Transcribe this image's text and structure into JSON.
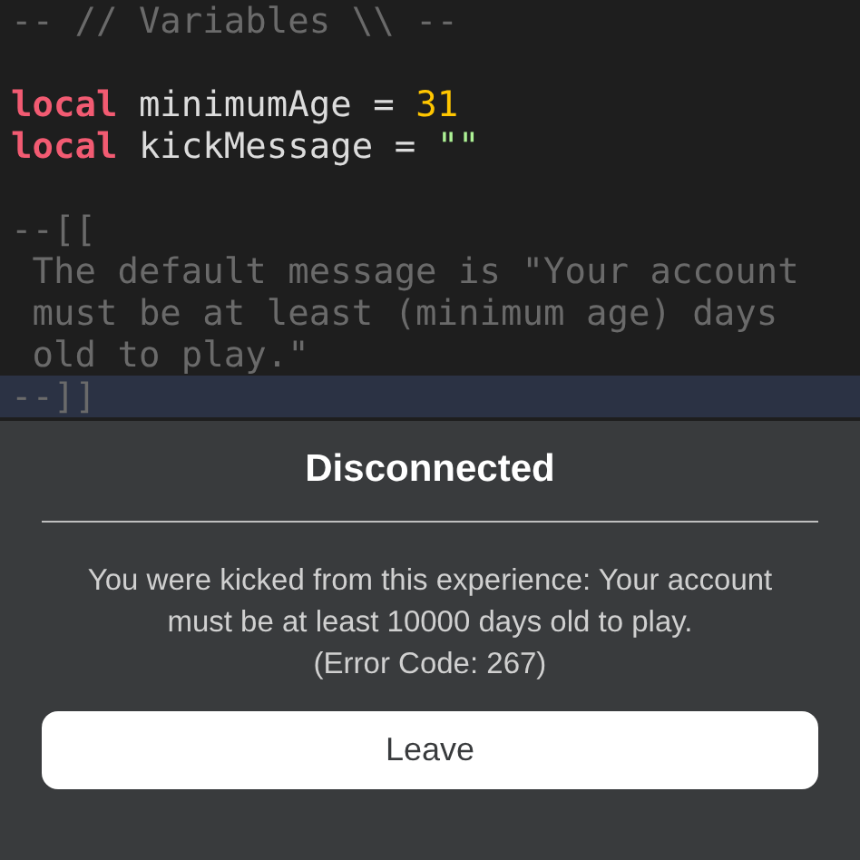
{
  "code": {
    "lines": [
      {
        "selected": false,
        "tokens": [
          {
            "kind": "comment",
            "text": "-- // Variables \\\\ --"
          }
        ]
      },
      {
        "selected": false
      },
      {
        "selected": false,
        "tokens": [
          {
            "kind": "keyword",
            "text": "local"
          },
          {
            "kind": "plain",
            "text": " minimumAge = "
          },
          {
            "kind": "number",
            "text": "31"
          }
        ]
      },
      {
        "selected": false,
        "tokens": [
          {
            "kind": "keyword",
            "text": "local"
          },
          {
            "kind": "plain",
            "text": " kickMessage = "
          },
          {
            "kind": "string",
            "text": "\"\""
          }
        ]
      },
      {
        "selected": false
      },
      {
        "selected": false,
        "tokens": [
          {
            "kind": "comment",
            "text": "--[["
          }
        ]
      },
      {
        "selected": false,
        "tokens": [
          {
            "kind": "comment",
            "text": " The default message is \"Your account"
          }
        ]
      },
      {
        "selected": false,
        "tokens": [
          {
            "kind": "comment",
            "text": " must be at least (minimum age) days"
          }
        ]
      },
      {
        "selected": false,
        "tokens": [
          {
            "kind": "comment",
            "text": " old to play.\""
          }
        ]
      },
      {
        "selected": true,
        "tokens": [
          {
            "kind": "comment",
            "text": "--]]"
          }
        ]
      }
    ]
  },
  "dialog": {
    "title": "Disconnected",
    "message": "You were kicked from this experience: Your account must be at least 10000 days old to play.",
    "error_code": "(Error Code: 267)",
    "button": "Leave"
  }
}
